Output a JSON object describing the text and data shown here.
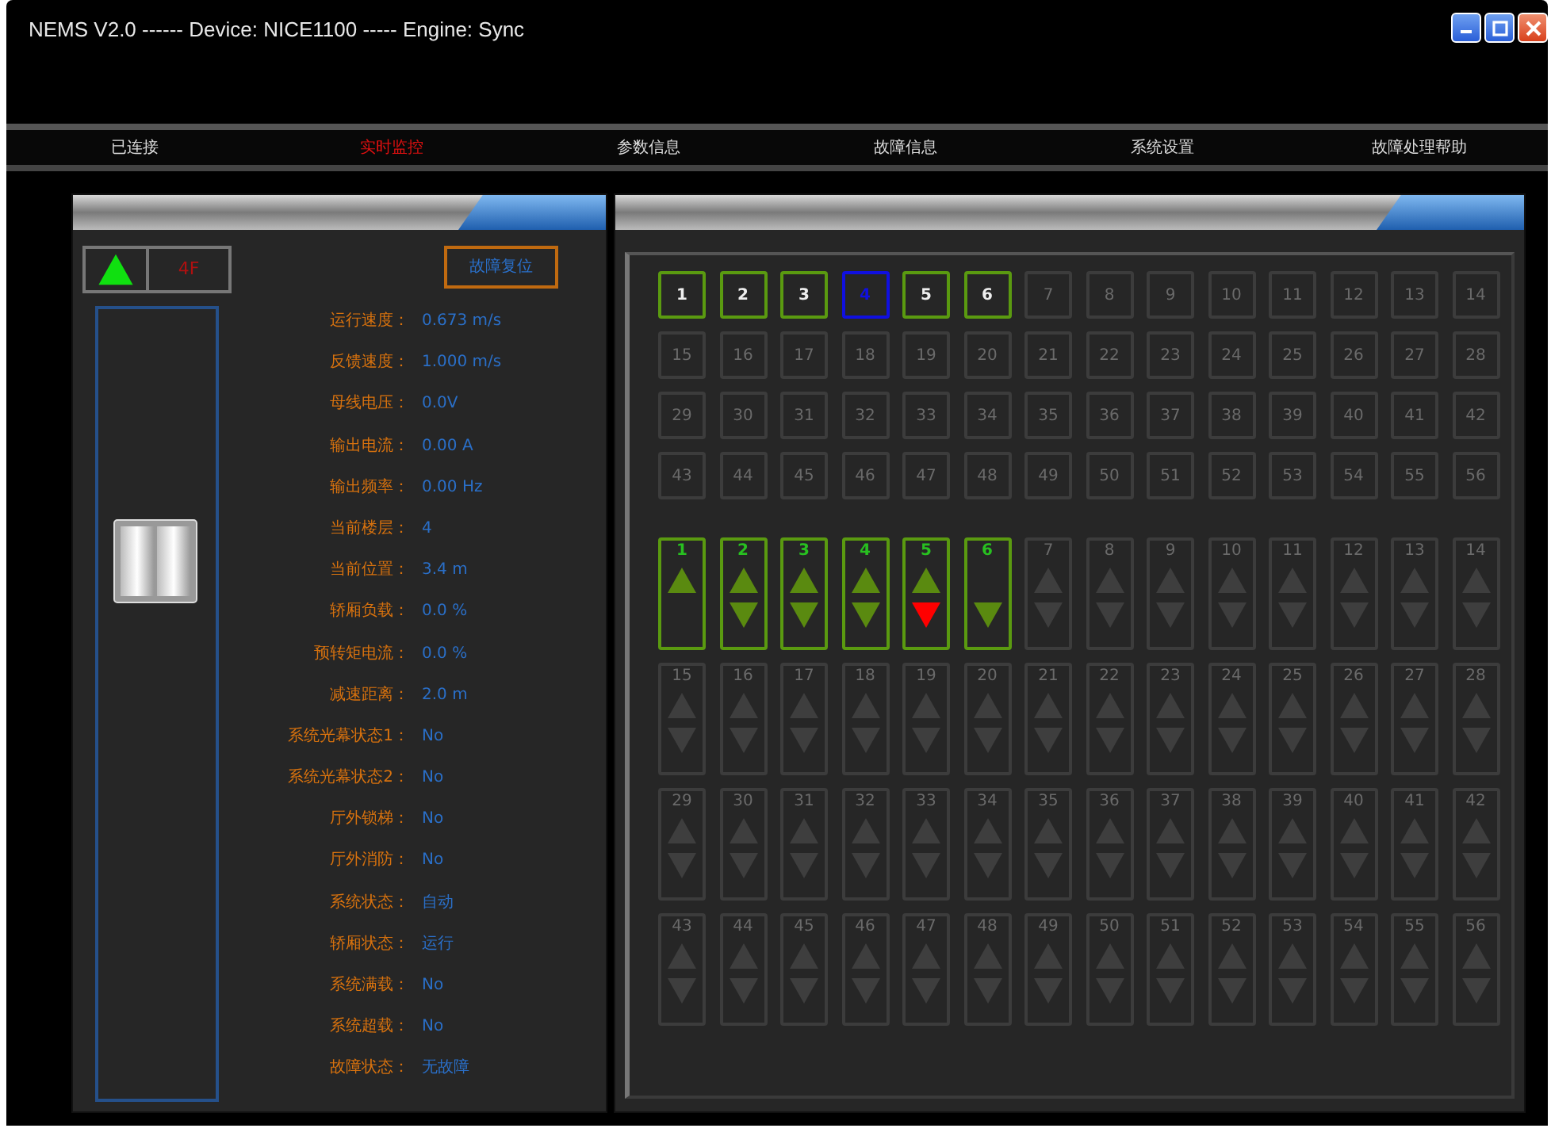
{
  "window": {
    "title": "NEMS V2.0 ------ Device: NICE1100 ----- Engine: Sync"
  },
  "menu": [
    {
      "label": "已连接",
      "selected": false
    },
    {
      "label": "实时监控",
      "selected": true
    },
    {
      "label": "参数信息",
      "selected": false
    },
    {
      "label": "故障信息",
      "selected": false
    },
    {
      "label": "系统设置",
      "selected": false
    },
    {
      "label": "故障处理帮助",
      "selected": false
    }
  ],
  "status": {
    "moving_up": true,
    "floor": "4F",
    "reset_button": "故障复位"
  },
  "shaft": {
    "level": 0.68
  },
  "params": [
    {
      "label": "运行速度：",
      "value": "0.673 m/s"
    },
    {
      "label": "反馈速度：",
      "value": "1.000 m/s"
    },
    {
      "label": "母线电压：",
      "value": "0.0V"
    },
    {
      "label": "输出电流：",
      "value": "0.00 A"
    },
    {
      "label": "输出频率：",
      "value": "0.00 Hz"
    },
    {
      "label": "当前楼层：",
      "value": "4"
    },
    {
      "label": "当前位置：",
      "value": "3.4 m"
    },
    {
      "label": "轿厢负载：",
      "value": "0.0 %"
    },
    {
      "label": "预转矩电流：",
      "value": "0.0 %"
    },
    {
      "label": "减速距离：",
      "value": "2.0 m"
    },
    {
      "label": "系统光幕状态1：",
      "value": "No"
    },
    {
      "label": "系统光幕状态2：",
      "value": "No"
    },
    {
      "label": "厅外锁梯：",
      "value": "No"
    },
    {
      "label": "厅外消防：",
      "value": "No"
    },
    {
      "label": "系统状态：",
      "value": "自动"
    },
    {
      "label": "轿厢状态：",
      "value": "运行"
    },
    {
      "label": "系统满载：",
      "value": "No"
    },
    {
      "label": "系统超载：",
      "value": "No"
    },
    {
      "label": "故障状态：",
      "value": "无故障"
    }
  ],
  "car_calls": [
    {
      "label": "1",
      "enabled": true,
      "selected": false
    },
    {
      "label": "2",
      "enabled": true,
      "selected": false
    },
    {
      "label": "3",
      "enabled": true,
      "selected": false
    },
    {
      "label": "4",
      "enabled": true,
      "selected": true
    },
    {
      "label": "5",
      "enabled": true,
      "selected": false
    },
    {
      "label": "6",
      "enabled": true,
      "selected": false
    },
    {
      "label": "7",
      "enabled": false,
      "selected": false
    },
    {
      "label": "8",
      "enabled": false,
      "selected": false
    },
    {
      "label": "9",
      "enabled": false,
      "selected": false
    },
    {
      "label": "10",
      "enabled": false,
      "selected": false
    },
    {
      "label": "11",
      "enabled": false,
      "selected": false
    },
    {
      "label": "12",
      "enabled": false,
      "selected": false
    },
    {
      "label": "13",
      "enabled": false,
      "selected": false
    },
    {
      "label": "14",
      "enabled": false,
      "selected": false
    },
    {
      "label": "15",
      "enabled": false,
      "selected": false
    },
    {
      "label": "16",
      "enabled": false,
      "selected": false
    },
    {
      "label": "17",
      "enabled": false,
      "selected": false
    },
    {
      "label": "18",
      "enabled": false,
      "selected": false
    },
    {
      "label": "19",
      "enabled": false,
      "selected": false
    },
    {
      "label": "20",
      "enabled": false,
      "selected": false
    },
    {
      "label": "21",
      "enabled": false,
      "selected": false
    },
    {
      "label": "22",
      "enabled": false,
      "selected": false
    },
    {
      "label": "23",
      "enabled": false,
      "selected": false
    },
    {
      "label": "24",
      "enabled": false,
      "selected": false
    },
    {
      "label": "25",
      "enabled": false,
      "selected": false
    },
    {
      "label": "26",
      "enabled": false,
      "selected": false
    },
    {
      "label": "27",
      "enabled": false,
      "selected": false
    },
    {
      "label": "28",
      "enabled": false,
      "selected": false
    },
    {
      "label": "29",
      "enabled": false,
      "selected": false
    },
    {
      "label": "30",
      "enabled": false,
      "selected": false
    },
    {
      "label": "31",
      "enabled": false,
      "selected": false
    },
    {
      "label": "32",
      "enabled": false,
      "selected": false
    },
    {
      "label": "33",
      "enabled": false,
      "selected": false
    },
    {
      "label": "34",
      "enabled": false,
      "selected": false
    },
    {
      "label": "35",
      "enabled": false,
      "selected": false
    },
    {
      "label": "36",
      "enabled": false,
      "selected": false
    },
    {
      "label": "37",
      "enabled": false,
      "selected": false
    },
    {
      "label": "38",
      "enabled": false,
      "selected": false
    },
    {
      "label": "39",
      "enabled": false,
      "selected": false
    },
    {
      "label": "40",
      "enabled": false,
      "selected": false
    },
    {
      "label": "41",
      "enabled": false,
      "selected": false
    },
    {
      "label": "42",
      "enabled": false,
      "selected": false
    },
    {
      "label": "43",
      "enabled": false,
      "selected": false
    },
    {
      "label": "44",
      "enabled": false,
      "selected": false
    },
    {
      "label": "45",
      "enabled": false,
      "selected": false
    },
    {
      "label": "46",
      "enabled": false,
      "selected": false
    },
    {
      "label": "47",
      "enabled": false,
      "selected": false
    },
    {
      "label": "48",
      "enabled": false,
      "selected": false
    },
    {
      "label": "49",
      "enabled": false,
      "selected": false
    },
    {
      "label": "50",
      "enabled": false,
      "selected": false
    },
    {
      "label": "51",
      "enabled": false,
      "selected": false
    },
    {
      "label": "52",
      "enabled": false,
      "selected": false
    },
    {
      "label": "53",
      "enabled": false,
      "selected": false
    },
    {
      "label": "54",
      "enabled": false,
      "selected": false
    },
    {
      "label": "55",
      "enabled": false,
      "selected": false
    },
    {
      "label": "56",
      "enabled": false,
      "selected": false
    }
  ],
  "hall_calls": [
    {
      "label": "1",
      "enabled": true,
      "arrows": [
        {
          "kind": "up",
          "called": false
        }
      ]
    },
    {
      "label": "2",
      "enabled": true,
      "arrows": [
        {
          "kind": "up",
          "called": false
        },
        {
          "kind": "down",
          "called": false
        }
      ]
    },
    {
      "label": "3",
      "enabled": true,
      "arrows": [
        {
          "kind": "up",
          "called": false
        },
        {
          "kind": "down",
          "called": false
        }
      ]
    },
    {
      "label": "4",
      "enabled": true,
      "arrows": [
        {
          "kind": "up",
          "called": false
        },
        {
          "kind": "down",
          "called": false
        }
      ]
    },
    {
      "label": "5",
      "enabled": true,
      "arrows": [
        {
          "kind": "up",
          "called": false
        },
        {
          "kind": "down",
          "called": true
        }
      ]
    },
    {
      "label": "6",
      "enabled": true,
      "arrows": [
        {
          "kind": "down",
          "called": false
        }
      ]
    },
    {
      "label": "7",
      "enabled": false,
      "arrows": [
        {
          "kind": "up",
          "called": false
        },
        {
          "kind": "down",
          "called": false
        }
      ]
    },
    {
      "label": "8",
      "enabled": false,
      "arrows": [
        {
          "kind": "up",
          "called": false
        },
        {
          "kind": "down",
          "called": false
        }
      ]
    },
    {
      "label": "9",
      "enabled": false,
      "arrows": [
        {
          "kind": "up",
          "called": false
        },
        {
          "kind": "down",
          "called": false
        }
      ]
    },
    {
      "label": "10",
      "enabled": false,
      "arrows": [
        {
          "kind": "up",
          "called": false
        },
        {
          "kind": "down",
          "called": false
        }
      ]
    },
    {
      "label": "11",
      "enabled": false,
      "arrows": [
        {
          "kind": "up",
          "called": false
        },
        {
          "kind": "down",
          "called": false
        }
      ]
    },
    {
      "label": "12",
      "enabled": false,
      "arrows": [
        {
          "kind": "up",
          "called": false
        },
        {
          "kind": "down",
          "called": false
        }
      ]
    },
    {
      "label": "13",
      "enabled": false,
      "arrows": [
        {
          "kind": "up",
          "called": false
        },
        {
          "kind": "down",
          "called": false
        }
      ]
    },
    {
      "label": "14",
      "enabled": false,
      "arrows": [
        {
          "kind": "up",
          "called": false
        },
        {
          "kind": "down",
          "called": false
        }
      ]
    },
    {
      "label": "15",
      "enabled": false,
      "arrows": [
        {
          "kind": "up",
          "called": false
        },
        {
          "kind": "down",
          "called": false
        }
      ]
    },
    {
      "label": "16",
      "enabled": false,
      "arrows": [
        {
          "kind": "up",
          "called": false
        },
        {
          "kind": "down",
          "called": false
        }
      ]
    },
    {
      "label": "17",
      "enabled": false,
      "arrows": [
        {
          "kind": "up",
          "called": false
        },
        {
          "kind": "down",
          "called": false
        }
      ]
    },
    {
      "label": "18",
      "enabled": false,
      "arrows": [
        {
          "kind": "up",
          "called": false
        },
        {
          "kind": "down",
          "called": false
        }
      ]
    },
    {
      "label": "19",
      "enabled": false,
      "arrows": [
        {
          "kind": "up",
          "called": false
        },
        {
          "kind": "down",
          "called": false
        }
      ]
    },
    {
      "label": "20",
      "enabled": false,
      "arrows": [
        {
          "kind": "up",
          "called": false
        },
        {
          "kind": "down",
          "called": false
        }
      ]
    },
    {
      "label": "21",
      "enabled": false,
      "arrows": [
        {
          "kind": "up",
          "called": false
        },
        {
          "kind": "down",
          "called": false
        }
      ]
    },
    {
      "label": "22",
      "enabled": false,
      "arrows": [
        {
          "kind": "up",
          "called": false
        },
        {
          "kind": "down",
          "called": false
        }
      ]
    },
    {
      "label": "23",
      "enabled": false,
      "arrows": [
        {
          "kind": "up",
          "called": false
        },
        {
          "kind": "down",
          "called": false
        }
      ]
    },
    {
      "label": "24",
      "enabled": false,
      "arrows": [
        {
          "kind": "up",
          "called": false
        },
        {
          "kind": "down",
          "called": false
        }
      ]
    },
    {
      "label": "25",
      "enabled": false,
      "arrows": [
        {
          "kind": "up",
          "called": false
        },
        {
          "kind": "down",
          "called": false
        }
      ]
    },
    {
      "label": "26",
      "enabled": false,
      "arrows": [
        {
          "kind": "up",
          "called": false
        },
        {
          "kind": "down",
          "called": false
        }
      ]
    },
    {
      "label": "27",
      "enabled": false,
      "arrows": [
        {
          "kind": "up",
          "called": false
        },
        {
          "kind": "down",
          "called": false
        }
      ]
    },
    {
      "label": "28",
      "enabled": false,
      "arrows": [
        {
          "kind": "up",
          "called": false
        },
        {
          "kind": "down",
          "called": false
        }
      ]
    },
    {
      "label": "29",
      "enabled": false,
      "arrows": [
        {
          "kind": "up",
          "called": false
        },
        {
          "kind": "down",
          "called": false
        }
      ]
    },
    {
      "label": "30",
      "enabled": false,
      "arrows": [
        {
          "kind": "up",
          "called": false
        },
        {
          "kind": "down",
          "called": false
        }
      ]
    },
    {
      "label": "31",
      "enabled": false,
      "arrows": [
        {
          "kind": "up",
          "called": false
        },
        {
          "kind": "down",
          "called": false
        }
      ]
    },
    {
      "label": "32",
      "enabled": false,
      "arrows": [
        {
          "kind": "up",
          "called": false
        },
        {
          "kind": "down",
          "called": false
        }
      ]
    },
    {
      "label": "33",
      "enabled": false,
      "arrows": [
        {
          "kind": "up",
          "called": false
        },
        {
          "kind": "down",
          "called": false
        }
      ]
    },
    {
      "label": "34",
      "enabled": false,
      "arrows": [
        {
          "kind": "up",
          "called": false
        },
        {
          "kind": "down",
          "called": false
        }
      ]
    },
    {
      "label": "35",
      "enabled": false,
      "arrows": [
        {
          "kind": "up",
          "called": false
        },
        {
          "kind": "down",
          "called": false
        }
      ]
    },
    {
      "label": "36",
      "enabled": false,
      "arrows": [
        {
          "kind": "up",
          "called": false
        },
        {
          "kind": "down",
          "called": false
        }
      ]
    },
    {
      "label": "37",
      "enabled": false,
      "arrows": [
        {
          "kind": "up",
          "called": false
        },
        {
          "kind": "down",
          "called": false
        }
      ]
    },
    {
      "label": "38",
      "enabled": false,
      "arrows": [
        {
          "kind": "up",
          "called": false
        },
        {
          "kind": "down",
          "called": false
        }
      ]
    },
    {
      "label": "39",
      "enabled": false,
      "arrows": [
        {
          "kind": "up",
          "called": false
        },
        {
          "kind": "down",
          "called": false
        }
      ]
    },
    {
      "label": "40",
      "enabled": false,
      "arrows": [
        {
          "kind": "up",
          "called": false
        },
        {
          "kind": "down",
          "called": false
        }
      ]
    },
    {
      "label": "41",
      "enabled": false,
      "arrows": [
        {
          "kind": "up",
          "called": false
        },
        {
          "kind": "down",
          "called": false
        }
      ]
    },
    {
      "label": "42",
      "enabled": false,
      "arrows": [
        {
          "kind": "up",
          "called": false
        },
        {
          "kind": "down",
          "called": false
        }
      ]
    },
    {
      "label": "43",
      "enabled": false,
      "arrows": [
        {
          "kind": "up",
          "called": false
        },
        {
          "kind": "down",
          "called": false
        }
      ]
    },
    {
      "label": "44",
      "enabled": false,
      "arrows": [
        {
          "kind": "up",
          "called": false
        },
        {
          "kind": "down",
          "called": false
        }
      ]
    },
    {
      "label": "45",
      "enabled": false,
      "arrows": [
        {
          "kind": "up",
          "called": false
        },
        {
          "kind": "down",
          "called": false
        }
      ]
    },
    {
      "label": "46",
      "enabled": false,
      "arrows": [
        {
          "kind": "up",
          "called": false
        },
        {
          "kind": "down",
          "called": false
        }
      ]
    },
    {
      "label": "47",
      "enabled": false,
      "arrows": [
        {
          "kind": "up",
          "called": false
        },
        {
          "kind": "down",
          "called": false
        }
      ]
    },
    {
      "label": "48",
      "enabled": false,
      "arrows": [
        {
          "kind": "up",
          "called": false
        },
        {
          "kind": "down",
          "called": false
        }
      ]
    },
    {
      "label": "49",
      "enabled": false,
      "arrows": [
        {
          "kind": "up",
          "called": false
        },
        {
          "kind": "down",
          "called": false
        }
      ]
    },
    {
      "label": "50",
      "enabled": false,
      "arrows": [
        {
          "kind": "up",
          "called": false
        },
        {
          "kind": "down",
          "called": false
        }
      ]
    },
    {
      "label": "51",
      "enabled": false,
      "arrows": [
        {
          "kind": "up",
          "called": false
        },
        {
          "kind": "down",
          "called": false
        }
      ]
    },
    {
      "label": "52",
      "enabled": false,
      "arrows": [
        {
          "kind": "up",
          "called": false
        },
        {
          "kind": "down",
          "called": false
        }
      ]
    },
    {
      "label": "53",
      "enabled": false,
      "arrows": [
        {
          "kind": "up",
          "called": false
        },
        {
          "kind": "down",
          "called": false
        }
      ]
    },
    {
      "label": "54",
      "enabled": false,
      "arrows": [
        {
          "kind": "up",
          "called": false
        },
        {
          "kind": "down",
          "called": false
        }
      ]
    },
    {
      "label": "55",
      "enabled": false,
      "arrows": [
        {
          "kind": "up",
          "called": false
        },
        {
          "kind": "down",
          "called": false
        }
      ]
    },
    {
      "label": "56",
      "enabled": false,
      "arrows": [
        {
          "kind": "up",
          "called": false
        },
        {
          "kind": "down",
          "called": false
        }
      ]
    }
  ]
}
